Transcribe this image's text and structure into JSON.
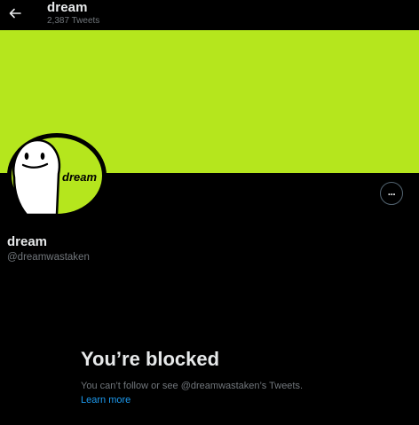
{
  "header": {
    "title": "dream",
    "tweet_count": "2,387 Tweets",
    "back_icon": "arrow-left-icon"
  },
  "banner": {
    "color": "#b5e61d"
  },
  "avatar": {
    "text": "dream"
  },
  "profile": {
    "name": "dream",
    "handle": "@dreamwastaken",
    "more_icon": "more-dots-icon"
  },
  "blocked": {
    "title": "You’re blocked",
    "message": "You can’t follow or see @dreamwastaken’s Tweets.",
    "learn_more": "Learn more"
  },
  "colors": {
    "background": "#000000",
    "text_primary": "#e7e9ea",
    "text_secondary": "#71767b",
    "link": "#1d9bf0"
  }
}
